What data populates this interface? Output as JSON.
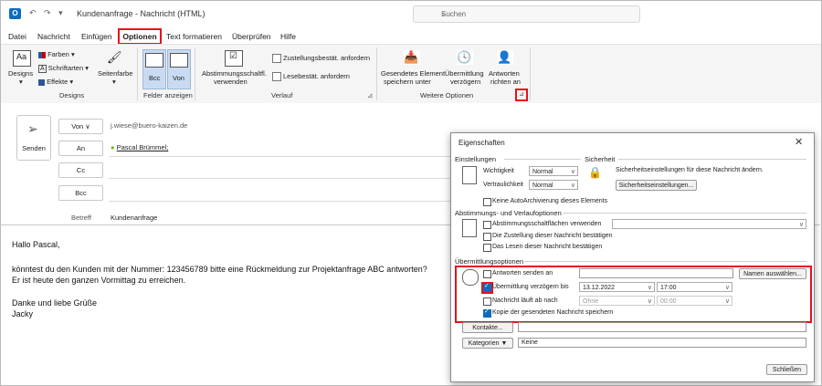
{
  "window": {
    "title": "Kundenanfrage - Nachricht (HTML)",
    "search_placeholder": "Suchen"
  },
  "menu": {
    "items": [
      "Datei",
      "Nachricht",
      "Einfügen",
      "Optionen",
      "Text formatieren",
      "Überprüfen",
      "Hilfe"
    ],
    "active": "Optionen"
  },
  "ribbon": {
    "designs": {
      "designs_label": "Designs",
      "farben": "Farben",
      "schriftarten": "Schriftarten",
      "effekte": "Effekte",
      "seitenfarbe": "Seitenfarbe",
      "group": "Designs"
    },
    "felder": {
      "bcc": "Bcc",
      "von": "Von",
      "group": "Felder anzeigen"
    },
    "verlauf": {
      "abstimmung": "Abstimmungsschaltfl.",
      "abstimmung2": "verwenden",
      "zustellung": "Zustellungsbestät. anfordern",
      "lese": "Lesebestät. anfordern",
      "group": "Verlauf"
    },
    "weitere": {
      "gesendetes1": "Gesendetes Element",
      "gesendetes2": "speichern unter",
      "uebermittlung1": "Übermittlung",
      "uebermittlung2": "verzögern",
      "antworten1": "Antworten",
      "antworten2": "richten an",
      "group": "Weitere Optionen"
    }
  },
  "compose": {
    "send_label": "Senden",
    "from_button": "Von",
    "from_value": "j.wiese@buero-kaizen.de",
    "to_button": "An",
    "to_value": "Pascal Brümmel;",
    "cc_button": "Cc",
    "bcc_button": "Bcc",
    "subject_label": "Betreff",
    "subject_value": "Kundenanfrage",
    "body": [
      "Hallo Pascal,",
      "könntest du den Kunden mit der Nummer: 123456789 bitte eine Rückmeldung zur Projektanfrage ABC antworten?",
      "Er ist heute den ganzen Vormittag zu erreichen.",
      "Danke und liebe Grüße",
      "Jacky"
    ]
  },
  "dialog": {
    "title": "Eigenschaften",
    "einstellungen": "Einstellungen",
    "wichtigkeit_label": "Wichtigkeit",
    "wichtigkeit_value": "Normal",
    "vertraulichkeit_label": "Vertraulichkeit",
    "vertraulichkeit_value": "Normal",
    "sicherheit": "Sicherheit",
    "sicherheit_text": "Sicherheitseinstellungen für diese Nachricht ändern.",
    "sicherheit_button": "Sicherheitseinstellungen...",
    "autoarchiv": "Keine AutoArchivierung dieses Elements",
    "abstimmung_section": "Abstimmungs- und Verlaufoptionen",
    "abstimmung_cb": "Abstimmungsschaltflächen verwenden",
    "zustellung_cb": "Die Zustellung dieser Nachricht bestätigen",
    "lesen_cb": "Das Lesen dieser Nachricht bestätigen",
    "uebermittlung_section": "Übermittlungsoptionen",
    "antworten_cb": "Antworten senden an",
    "namen_button": "Namen auswählen...",
    "verzoegern_cb": "Übermittlung verzögern bis",
    "verzoegern_date": "13.12.2022",
    "verzoegern_time": "17:00",
    "ablauf_cb": "Nachricht läuft ab nach",
    "ablauf_date": "Ohne",
    "ablauf_time": "00:00",
    "kopie_cb": "Kopie der gesendeten Nachricht speichern",
    "kontakte_button": "Kontakte...",
    "kategorien_button": "Kategorien",
    "kategorien_value": "Keine",
    "close_button": "Schließen"
  },
  "colors": {
    "highlight": "#e5121c",
    "accent": "#0f6cbd",
    "presence": "#6bb700"
  }
}
